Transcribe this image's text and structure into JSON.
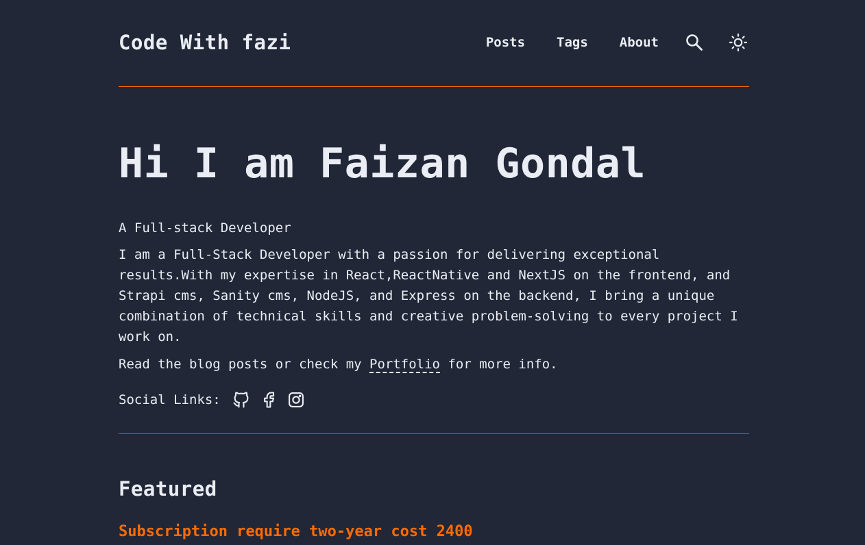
{
  "site": {
    "title": "Code With fazi"
  },
  "nav": {
    "items": [
      {
        "label": "Posts"
      },
      {
        "label": "Tags"
      },
      {
        "label": "About"
      }
    ],
    "search_icon": "search-icon",
    "theme_icon": "sun-icon"
  },
  "hero": {
    "heading": "Hi I am Faizan Gondal",
    "tagline": "A Full-stack Developer",
    "bio": "I am a Full-Stack Developer with a passion for delivering exceptional results.With my expertise in React,ReactNative and NextJS on the frontend, and Strapi cms, Sanity cms, NodeJS, and Express on the backend, I bring a unique combination of technical skills and creative problem-solving to every project I work on.",
    "read_prefix": "Read the blog posts or check my ",
    "portfolio_label": "Portfolio",
    "read_suffix": " for more info.",
    "social_label": "Social Links:",
    "social_icons": [
      "github-icon",
      "facebook-icon",
      "instagram-icon"
    ]
  },
  "featured": {
    "heading": "Featured",
    "posts": [
      {
        "title": "Subscription require two-year cost 2400"
      }
    ]
  },
  "colors": {
    "background": "#212737",
    "text": "#eaedf3",
    "accent": "#ff6b01"
  }
}
